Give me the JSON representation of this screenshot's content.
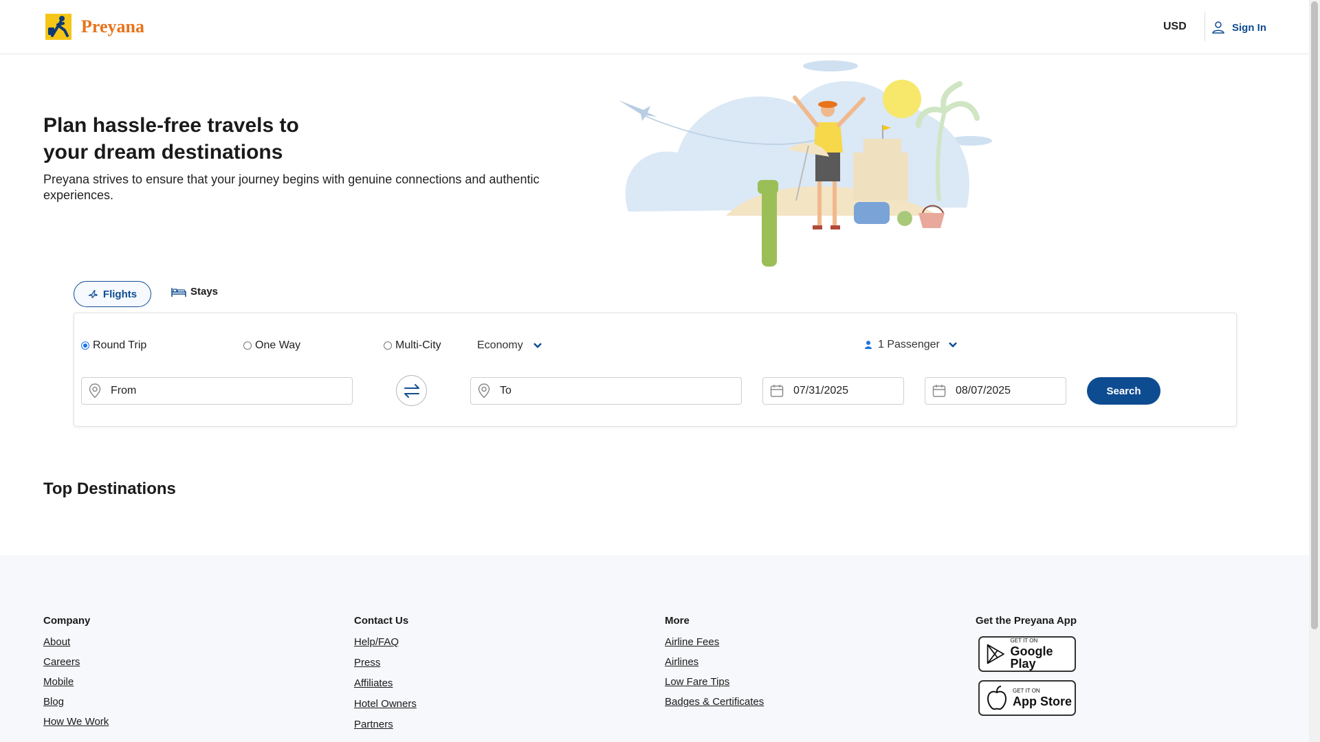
{
  "header": {
    "brand": "Preyana",
    "currency": "USD",
    "signin_label": "Sign In"
  },
  "hero": {
    "title_line1": "Plan hassle-free travels to",
    "title_line2": "your dream destinations",
    "subtitle": "Preyana strives to ensure that your journey begins with genuine connections and authentic experiences."
  },
  "tabs": [
    {
      "label": "Flights",
      "icon": "plane-icon",
      "active": true
    },
    {
      "label": "Stays",
      "icon": "bed-icon",
      "active": false
    }
  ],
  "search": {
    "trip_types": [
      {
        "label": "Round Trip",
        "selected": true
      },
      {
        "label": "One Way",
        "selected": false
      },
      {
        "label": "Multi-City",
        "selected": false
      }
    ],
    "cabin": "Economy",
    "passengers": "1 Passenger",
    "from_placeholder": "From",
    "to_placeholder": "To",
    "depart_date": "07/31/2025",
    "return_date": "08/07/2025",
    "search_label": "Search"
  },
  "top_destinations_title": "Top Destinations",
  "footer": {
    "company": {
      "title": "Company",
      "links": [
        "About",
        "Careers",
        "Mobile",
        "Blog",
        "How We Work"
      ]
    },
    "contact": {
      "title": "Contact Us",
      "links": [
        "Help/FAQ",
        "Press",
        "Affiliates",
        "Hotel Owners",
        "Partners"
      ]
    },
    "more": {
      "title": "More",
      "links": [
        "Airline Fees",
        "Airlines",
        "Low Fare Tips",
        "Badges & Certificates"
      ]
    },
    "app": {
      "title": "Get the Preyana App",
      "google": {
        "small": "GET IT ON",
        "big": "Google Play"
      },
      "apple": {
        "small": "GET IT ON",
        "big": "App Store"
      }
    }
  },
  "colors": {
    "brand_blue": "#0e4c92",
    "brand_orange": "#e8731a",
    "logo_yellow": "#f5c518"
  }
}
